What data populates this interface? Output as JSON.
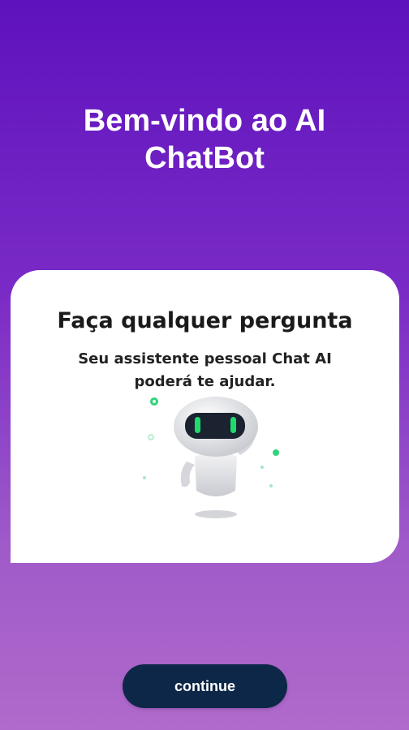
{
  "welcome": {
    "title_line1": "Bem-vindo ao AI",
    "title_line2": "ChatBot"
  },
  "card": {
    "heading": "Faça qualquer pergunta",
    "subtitle_line1": "Seu assistente pessoal Chat AI",
    "subtitle_line2": "poderá te ajudar.",
    "illustration": "robot-icon"
  },
  "actions": {
    "continue_label": "continue"
  },
  "colors": {
    "background_top": "#5e12bd",
    "background_bottom": "#b06acb",
    "button": "#0d2748",
    "robot_eyes": "#1ddc6c"
  }
}
